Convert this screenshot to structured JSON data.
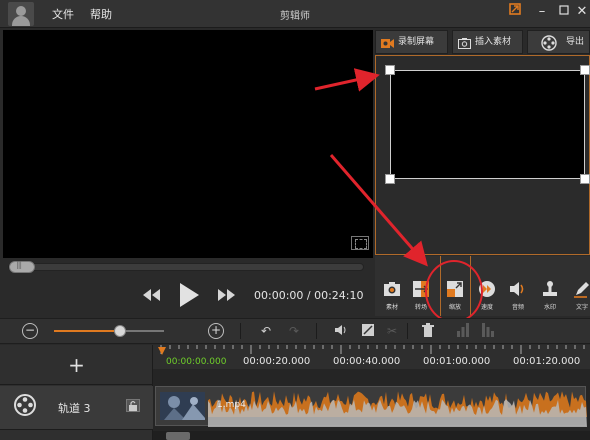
{
  "window": {
    "title": "剪辑师",
    "menu": [
      "文件",
      "帮助"
    ]
  },
  "right_panel": {
    "buttons": [
      {
        "label": "录制屏幕",
        "icon": "camera-record-icon"
      },
      {
        "label": "插入素材",
        "icon": "insert-media-icon"
      },
      {
        "label": "导出",
        "icon": "film-reel-icon"
      }
    ],
    "tools": [
      {
        "label": "素材",
        "icon": "media-icon"
      },
      {
        "label": "转场",
        "icon": "transition-icon"
      },
      {
        "label": "缩放",
        "icon": "zoom-crop-icon",
        "active": true
      },
      {
        "label": "速度",
        "icon": "speed-icon"
      },
      {
        "label": "音频",
        "icon": "audio-icon"
      },
      {
        "label": "水印",
        "icon": "watermark-icon"
      },
      {
        "label": "文字",
        "icon": "text-icon"
      }
    ]
  },
  "playback": {
    "current_time": "00:00:00",
    "total_time": "00:24:10",
    "time_display": "00:00:00 / 00:24:10",
    "seek_position": 0.0
  },
  "timeline": {
    "zoom_level": 0.6,
    "ruler_labels": [
      "00:00:00.000",
      "00:00:20.000",
      "00:00:40.000",
      "00:01:00.000",
      "00:01:20.000"
    ],
    "add_track_symbol": "+",
    "track_name": "轨道 3",
    "clip_name": "1.mp4"
  },
  "colors": {
    "accent": "#e07a20",
    "annotation_red": "#e0242c",
    "waveform": "#c8701e",
    "waveform_light": "#b8b8b8",
    "ruler_start": "#6fcf2a"
  }
}
